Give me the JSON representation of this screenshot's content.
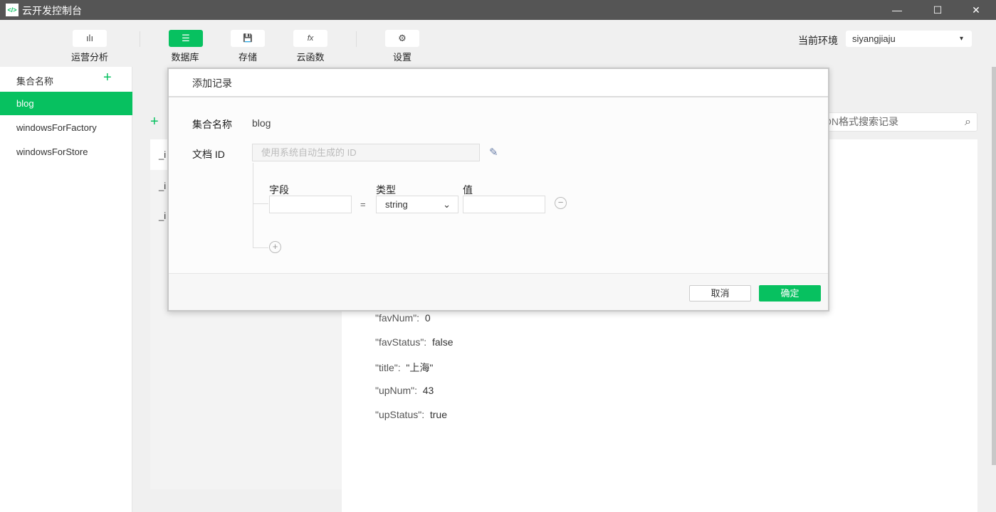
{
  "window": {
    "title": "云开发控制台",
    "logo": "</>",
    "minimize": "—",
    "maximize": "☐",
    "close": "✕"
  },
  "toolbar": {
    "items": [
      {
        "label": "运营分析",
        "icon": "ılı"
      },
      {
        "label": "数据库",
        "icon": "☰"
      },
      {
        "label": "存储",
        "icon": "💾"
      },
      {
        "label": "云函数",
        "icon": "fx"
      },
      {
        "label": "设置",
        "icon": "⚙"
      }
    ],
    "env_label": "当前环境",
    "env_value": "siyangjiaju",
    "env_caret": "▾"
  },
  "sidebar": {
    "header": "集合名称",
    "add": "+",
    "items": [
      "blog",
      "windowsForFactory",
      "windowsForStore"
    ]
  },
  "main": {
    "add": "+",
    "search_placeholder": "按JSON格式搜索记录",
    "search_visible": "格式搜索记录",
    "ids": [
      "_i",
      "_i",
      "_i"
    ],
    "record": [
      {
        "k": "\"favNum\":",
        "v": "0"
      },
      {
        "k": "\"favStatus\":",
        "v": "false"
      },
      {
        "k": "\"title\":",
        "v": "\"上海\""
      },
      {
        "k": "\"upNum\":",
        "v": "43"
      },
      {
        "k": "\"upStatus\":",
        "v": "true"
      }
    ]
  },
  "dialog": {
    "title": "添加记录",
    "collection_label": "集合名称",
    "collection_value": "blog",
    "docid_label": "文档 ID",
    "docid_placeholder": "使用系统自动生成的 ID",
    "field_label": "字段",
    "type_label": "类型",
    "value_label": "值",
    "eq": "=",
    "type_value": "string",
    "cancel": "取消",
    "confirm": "确定"
  },
  "colors": {
    "accent": "#07c160",
    "titlebar": "#555555"
  }
}
